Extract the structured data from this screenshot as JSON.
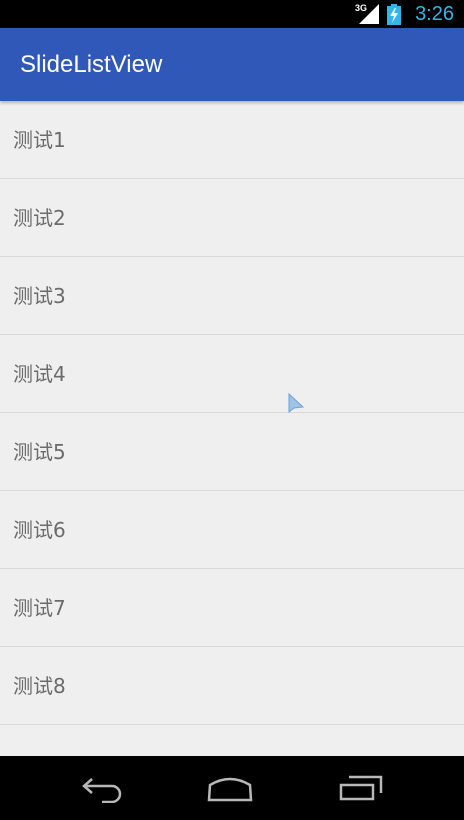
{
  "status_bar": {
    "network": "3G",
    "time": "3:26",
    "accent_color": "#33b5e5"
  },
  "app_bar": {
    "title": "SlideListView",
    "color": "#2f58b9"
  },
  "list": {
    "items": [
      {
        "label": "测试1"
      },
      {
        "label": "测试2"
      },
      {
        "label": "测试3"
      },
      {
        "label": "测试4"
      },
      {
        "label": "测试5"
      },
      {
        "label": "测试6"
      },
      {
        "label": "测试7"
      },
      {
        "label": "测试8"
      }
    ]
  },
  "nav_bar": {
    "icons": [
      "back-icon",
      "home-icon",
      "recent-apps-icon"
    ]
  }
}
